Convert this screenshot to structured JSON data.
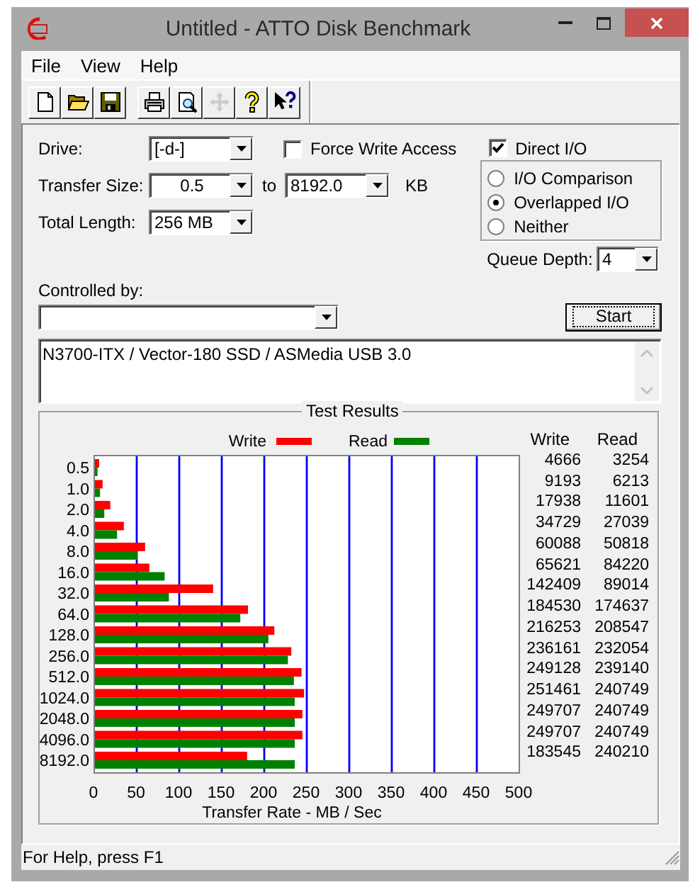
{
  "window": {
    "title": "Untitled - ATTO Disk Benchmark"
  },
  "menu": [
    "File",
    "View",
    "Help"
  ],
  "toolbar": [
    {
      "kind": "new",
      "disabled": false
    },
    {
      "kind": "open",
      "disabled": false
    },
    {
      "kind": "save",
      "disabled": false
    },
    {
      "kind": "print",
      "disabled": false,
      "group_start": true
    },
    {
      "kind": "preview",
      "disabled": false
    },
    {
      "kind": "move",
      "disabled": true
    },
    {
      "kind": "help",
      "disabled": false
    },
    {
      "kind": "context_help",
      "disabled": false
    }
  ],
  "form": {
    "drive": {
      "label": "Drive:",
      "value": "[-d-]"
    },
    "force_write_access": {
      "label": "Force Write Access",
      "checked": false
    },
    "transfer_size": {
      "label": "Transfer Size:",
      "from": "0.5",
      "to_label": "to",
      "to": "8192.0",
      "unit": "KB"
    },
    "total_length": {
      "label": "Total Length:",
      "value": "256 MB"
    },
    "direct_io": {
      "label": "Direct I/O",
      "checked": true
    },
    "io_modes": [
      {
        "label": "I/O Comparison",
        "selected": false
      },
      {
        "label": "Overlapped I/O",
        "selected": true
      },
      {
        "label": "Neither",
        "selected": false
      }
    ],
    "queue_depth": {
      "label": "Queue Depth:",
      "value": "4"
    },
    "controlled_by": {
      "label": "Controlled by:"
    },
    "start_button": {
      "label": "Start",
      "focused": true
    },
    "description": "N3700-ITX / Vector-180 SSD / ASMedia USB 3.0"
  },
  "test_results": {
    "title": "Test Results",
    "columns": [
      "Write",
      "Read"
    ],
    "rows": [
      {
        "write": "4666",
        "read": "3254"
      },
      {
        "write": "9193",
        "read": "6213"
      },
      {
        "write": "17938",
        "read": "11601"
      },
      {
        "write": "34729",
        "read": "27039"
      },
      {
        "write": "60088",
        "read": "50818"
      },
      {
        "write": "65621",
        "read": "84220"
      },
      {
        "write": "142409",
        "read": "89014"
      },
      {
        "write": "184530",
        "read": "174637"
      },
      {
        "write": "216253",
        "read": "208547"
      },
      {
        "write": "236161",
        "read": "232054"
      },
      {
        "write": "249128",
        "read": "239140"
      },
      {
        "write": "251461",
        "read": "240749"
      },
      {
        "write": "249707",
        "read": "240749"
      },
      {
        "write": "249707",
        "read": "240749"
      },
      {
        "write": "183545",
        "read": "240210"
      }
    ],
    "chart_data": {
      "type": "bar",
      "orientation": "horizontal",
      "xlabel": "Transfer Rate - MB / Sec",
      "categories": [
        "0.5",
        "1.0",
        "2.0",
        "4.0",
        "8.0",
        "16.0",
        "32.0",
        "64.0",
        "128.0",
        "256.0",
        "512.0",
        "1024.0",
        "2048.0",
        "4096.0",
        "8192.0"
      ],
      "series": [
        {
          "name": "Write",
          "color": "#ff0000",
          "values": [
            5,
            9,
            18,
            34,
            59,
            64,
            139,
            180,
            211,
            231,
            243,
            246,
            244,
            244,
            179
          ]
        },
        {
          "name": "Read",
          "color": "#008000",
          "values": [
            3,
            6,
            11,
            26,
            50,
            82,
            87,
            171,
            204,
            227,
            234,
            235,
            235,
            235,
            235
          ]
        }
      ],
      "grid": true,
      "legend": "top",
      "xlim": [
        0,
        500
      ],
      "xticks": [
        0,
        50,
        100,
        150,
        200,
        250,
        300,
        350,
        400,
        450,
        500
      ]
    }
  },
  "status_bar": "For Help, press F1"
}
